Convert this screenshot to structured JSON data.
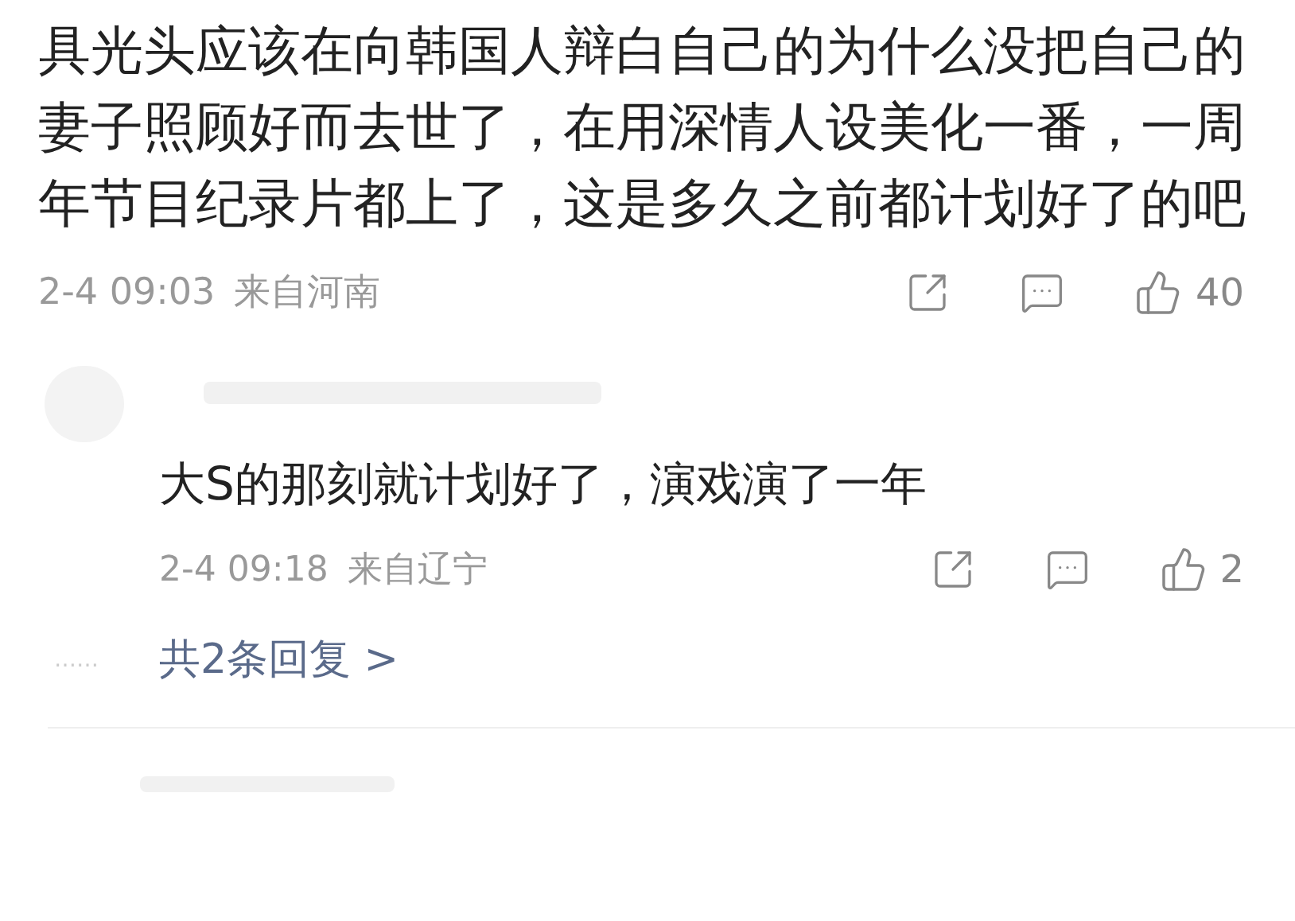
{
  "comment": {
    "text": "具光头应该在向韩国人辩白自己的为什么没把自己的妻子照顾好而去世了，在用深情人设美化一番，一周年节目纪录片都上了，这是多久之前都计划好了的吧",
    "time": "2-4 09:03",
    "location": "来自河南",
    "like_count": "40"
  },
  "reply": {
    "text": "大S的那刻就计划好了，演戏演了一年",
    "time": "2-4 09:18",
    "location": "来自辽宁",
    "like_count": "2"
  },
  "more_replies": {
    "dots": "……",
    "link": "共2条回复 >"
  }
}
